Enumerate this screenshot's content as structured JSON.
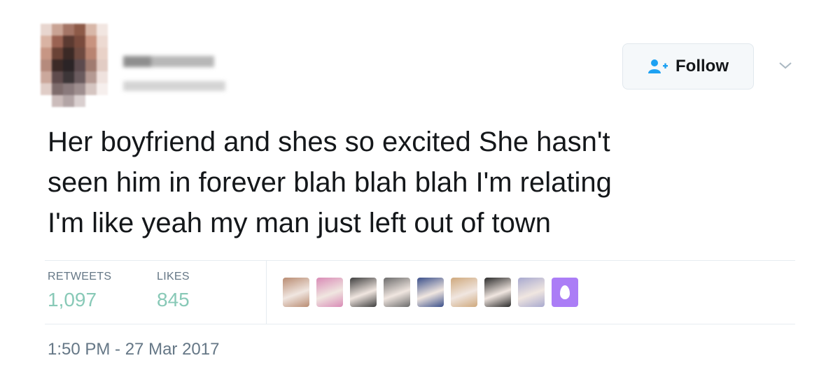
{
  "header": {
    "follow_label": "Follow"
  },
  "tweet": {
    "text": "Her boyfriend and shes so excited She hasn't\nseen him in forever blah blah blah I'm relating\nI'm like yeah my man just left out of town"
  },
  "stats": {
    "retweets_label": "RETWEETS",
    "retweets_count": "1,097",
    "likes_label": "LIKES",
    "likes_count": "845"
  },
  "likers": {
    "avatar_colors": [
      "#b98c72",
      "#d98bb6",
      "#3f3f3f",
      "#6b6b6b",
      "#3a4f8a",
      "#cfa97d",
      "#2b2b2b",
      "#a8a9cf"
    ],
    "more_color": "#ab7df6",
    "more_icon": "egg-icon"
  },
  "timestamp": "1:50 PM - 27 Mar 2017",
  "colors": {
    "text": "#14171a",
    "muted": "#657786",
    "stat_value": "#88c9b7",
    "follow_icon": "#1da1f2"
  }
}
